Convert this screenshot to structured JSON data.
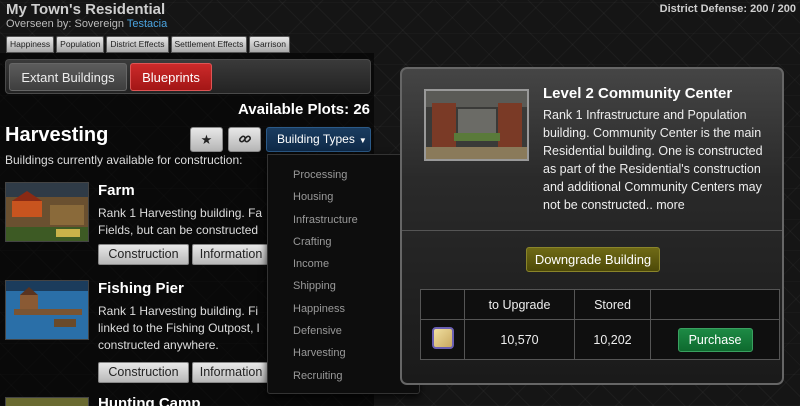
{
  "header": {
    "title": "My Town's Residential",
    "overseer_label": "Overseen by: Sovereign",
    "overseer_name": "Testacia",
    "district_defense": "District Defense: 200 / 200"
  },
  "subtabs": [
    "Happiness",
    "Population",
    "District Effects",
    "Settlement Effects",
    "Garrison"
  ],
  "top_tabs": {
    "extant": "Extant Buildings",
    "blueprints": "Blueprints"
  },
  "available_plots": "Available Plots: 26",
  "category": {
    "title": "Harvesting",
    "description": "Buildings currently available for construction:"
  },
  "building_types_button": "Building Types",
  "buildings": [
    {
      "name": "Farm",
      "description": "Rank 1 Harvesting building. Fa",
      "description_line2": "Fields, but can be constructed",
      "construct_label": "Construction",
      "info_label": "Information"
    },
    {
      "name": "Fishing Pier",
      "description": "Rank 1 Harvesting building. Fi",
      "description_line2": "linked to the Fishing Outpost, l",
      "description_line3": "constructed anywhere.",
      "construct_label": "Construction",
      "info_label": "Information"
    },
    {
      "name": "Hunting Camp"
    }
  ],
  "dropdown_items": [
    "Processing",
    "Housing",
    "Infrastructure",
    "Crafting",
    "Income",
    "Shipping",
    "Happiness",
    "Defensive",
    "Harvesting",
    "Recruiting"
  ],
  "detail": {
    "title": "Level 2 Community Center",
    "description": "Rank 1 Infrastructure and Population building. Community Center is the main Residential building. One is constructed as part of the Residential's construction and additional Community Centers may not be constructed.. more",
    "downgrade_label": "Downgrade Building",
    "table": {
      "headers": [
        "",
        "to Upgrade",
        "Stored",
        ""
      ],
      "row": {
        "to_upgrade": "10,570",
        "stored": "10,202",
        "purchase_label": "Purchase"
      }
    }
  }
}
